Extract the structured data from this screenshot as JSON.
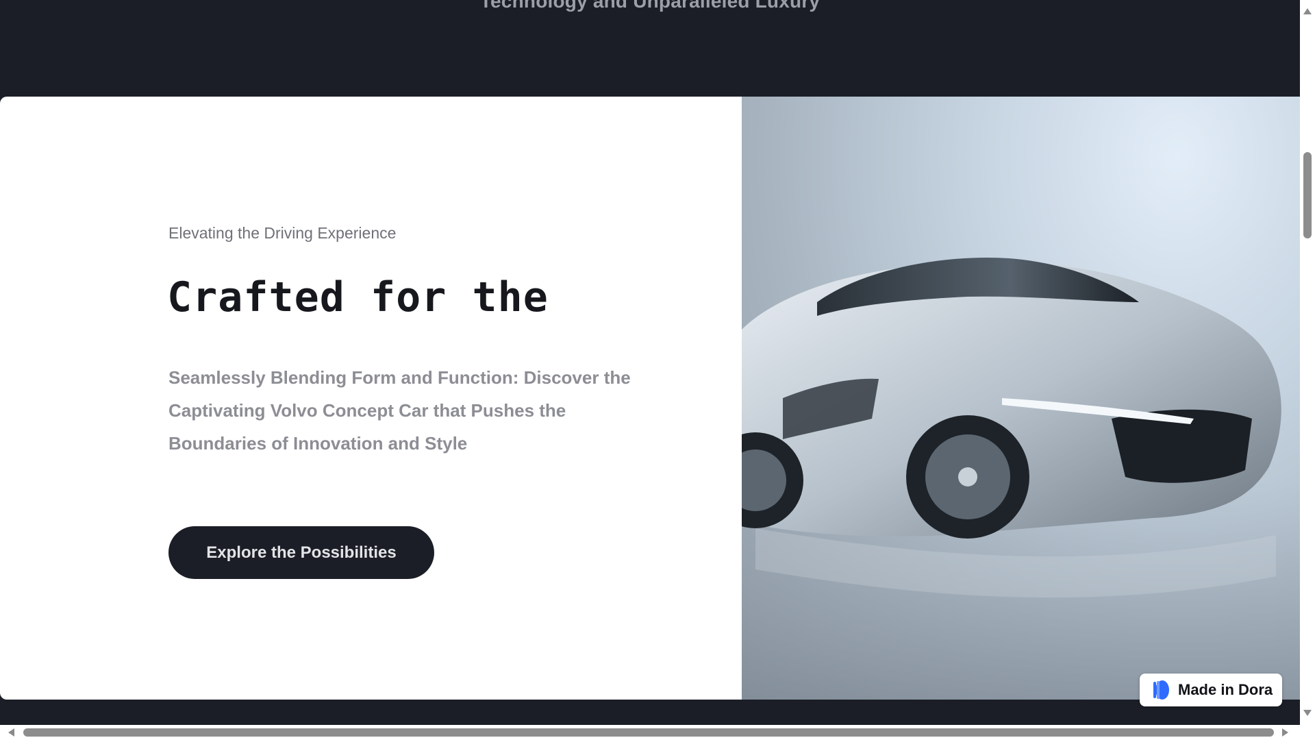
{
  "section_heading": "Technology and Unparalleled Luxury",
  "hero": {
    "eyebrow": "Elevating the Driving Experience",
    "headline": "Crafted for the",
    "description": "Seamlessly Blending Form and Function: Discover the Captivating Volvo Concept Car that Pushes the Boundaries of Innovation and Style",
    "cta_label": "Explore the Possibilities",
    "image_icon": "concept-car-photo"
  },
  "badge": {
    "label": "Made in Dora",
    "icon": "dora-logo-icon"
  },
  "colors": {
    "page_background": "#1b1e26",
    "card_background": "#ffffff",
    "cta_background": "#1b1e26",
    "badge_accent": "#2f6bff"
  }
}
